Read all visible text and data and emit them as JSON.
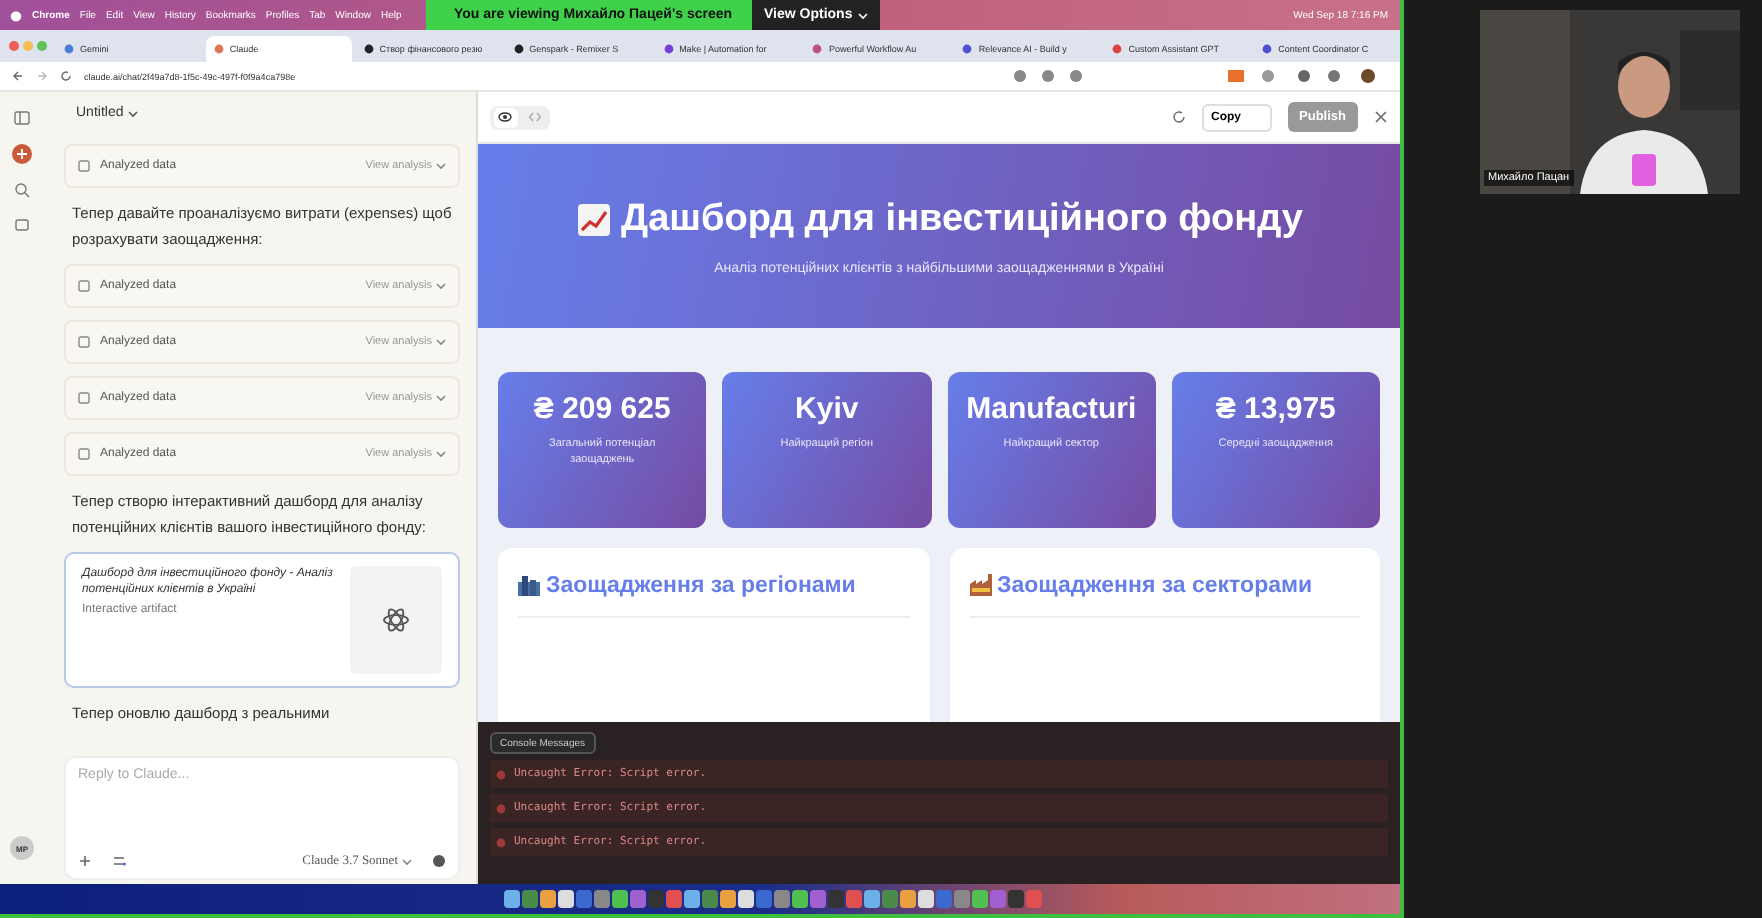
{
  "menu_bar": {
    "items": [
      "Chrome",
      "File",
      "Edit",
      "View",
      "History",
      "Bookmarks",
      "Profiles",
      "Tab",
      "Window",
      "Help"
    ],
    "clock": "Wed Sep 18 7:16 PM"
  },
  "zoom_banner": {
    "text": "You are viewing Михайло Пацей's screen",
    "view_options": "View Options"
  },
  "browser": {
    "tabs": [
      {
        "label": "Gemini",
        "selected": false
      },
      {
        "label": "Claude",
        "selected": true
      },
      {
        "label": "Створ фінансового резю",
        "selected": false
      },
      {
        "label": "Genspark - Remixer S",
        "selected": false
      },
      {
        "label": "Make | Automation for",
        "selected": false
      },
      {
        "label": "Powerful Workflow Au",
        "selected": false
      },
      {
        "label": "Relevance AI - Build y",
        "selected": false
      },
      {
        "label": "Custom Assistant GPT",
        "selected": false
      },
      {
        "label": "Content Coordinator C",
        "selected": false
      }
    ],
    "url": "claude.ai/chat/2f49a7d8-1f5c-49c-497f-f0f9a4ca798e"
  },
  "chat": {
    "title": "Untitled",
    "messages": [
      {
        "kind": "tool",
        "label": "Analyzed data",
        "action": "View analysis"
      },
      {
        "kind": "text",
        "text": "Тепер давайте проаналізуємо витрати (expenses) щоб розрахувати заощадження:"
      },
      {
        "kind": "tool",
        "label": "Analyzed data",
        "action": "View analysis"
      },
      {
        "kind": "tool",
        "label": "Analyzed data",
        "action": "View analysis"
      },
      {
        "kind": "tool",
        "label": "Analyzed data",
        "action": "View analysis"
      },
      {
        "kind": "tool",
        "label": "Analyzed data",
        "action": "View analysis"
      },
      {
        "kind": "text",
        "text": "Тепер створю інтерактивний дашборд для аналізу потенційних клієнтів вашого інвестиційного фонду:"
      },
      {
        "kind": "artifact",
        "title": "Дашборд для інвестиційного фонду - Аналіз потенційних клієнтів в Україні",
        "subtitle": "Interactive artifact"
      },
      {
        "kind": "text",
        "text": "Тепер оновлю дашборд з реальними"
      }
    ],
    "reply_placeholder": "Reply to Claude...",
    "model": "Claude 3.7 Sonnet",
    "avatar": "MP"
  },
  "artifact": {
    "views": [
      {
        "kind": "preview",
        "selected": true
      },
      {
        "kind": "code",
        "selected": false
      }
    ],
    "copy": "Copy",
    "publish": "Publish",
    "header": {
      "title": "Дашборд для інвестиційного фонду",
      "subtitle": "Аналіз потенційних клієнтів з найбільшими заощадженнями в Україні"
    },
    "stats": [
      {
        "value": "₴ 209 625",
        "label": "Загальний потенціал заощаджень"
      },
      {
        "value": "Kyiv",
        "label": "Найкращий регіон"
      },
      {
        "value": "Manufacturi",
        "label": "Найкращий сектор"
      },
      {
        "value": "₴ 13,975",
        "label": "Середні заощадження"
      }
    ],
    "sections": [
      {
        "kind": "city",
        "title": "Заощадження за регіонами"
      },
      {
        "kind": "factory",
        "title": "Заощадження за секторами"
      }
    ],
    "console": {
      "label": "Console Messages",
      "errors": [
        "Uncaught Error: Script error.",
        "Uncaught Error: Script error.",
        "Uncaught Error: Script error."
      ]
    }
  },
  "video": {
    "name": "Михайло Пацан"
  }
}
